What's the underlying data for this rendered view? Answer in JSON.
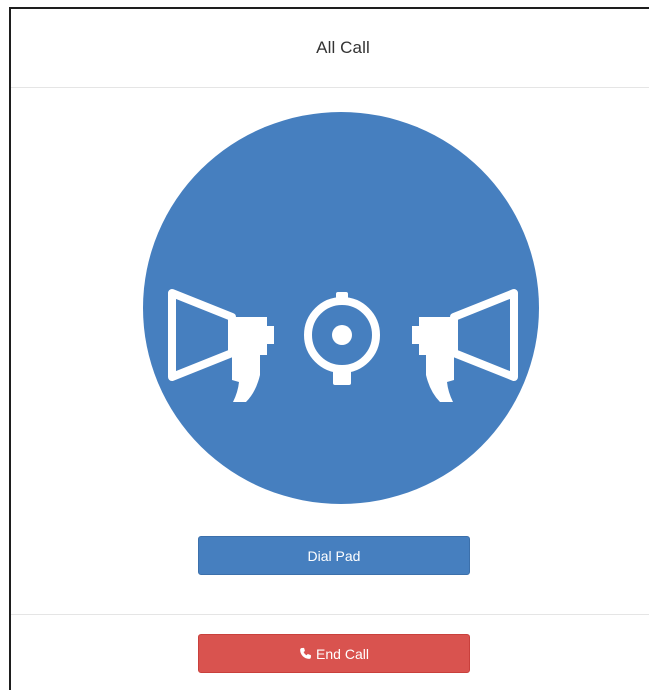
{
  "header": {
    "title": "All Call"
  },
  "main": {
    "icon": "megaphones-broadcast-icon",
    "accent_color": "#467fbf"
  },
  "buttons": {
    "dial_pad_label": "Dial Pad",
    "end_call_label": "End Call",
    "end_call_icon": "phone-icon",
    "end_call_color": "#d9534f"
  }
}
